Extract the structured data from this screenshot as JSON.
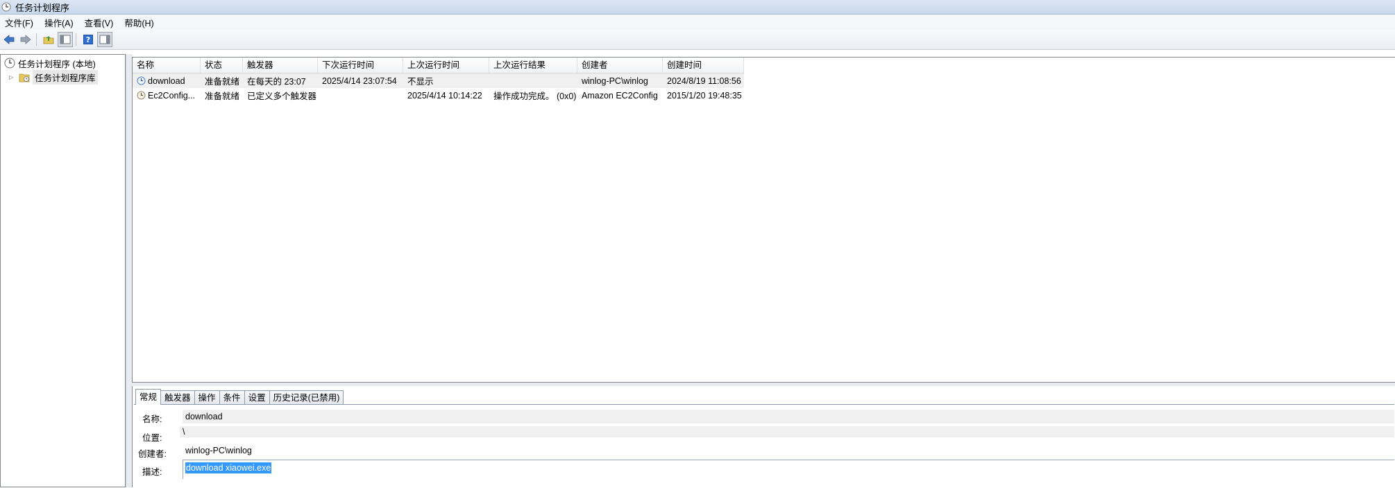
{
  "window": {
    "title": "任务计划程序",
    "icon": "clock-icon"
  },
  "menu": [
    "文件(F)",
    "操作(A)",
    "查看(V)",
    "帮助(H)"
  ],
  "toolbar": {
    "buttons": [
      "back-arrow-icon",
      "forward-arrow-icon",
      "folder-up-icon",
      "show-hide-tree-icon",
      "help-icon",
      "show-hide-action-pane-icon"
    ],
    "colors": {
      "arrow": "#3d78c6",
      "help": "#2f6fd1"
    }
  },
  "tree": {
    "root": "任务计划程序 (本地)",
    "child": "任务计划程序库"
  },
  "list": {
    "columns": [
      "名称",
      "状态",
      "触发器",
      "下次运行时间",
      "上次运行时间",
      "上次运行结果",
      "创建者",
      "创建时间"
    ],
    "rows": [
      {
        "name": "download",
        "status": "准备就绪",
        "trigger": "在每天的 23:07",
        "next_run": "2025/4/14 23:07:54",
        "last_run": "不显示",
        "last_result": "",
        "author": "winlog-PC\\winlog",
        "created": "2024/8/19 11:08:56"
      },
      {
        "name": "Ec2Config...",
        "status": "准备就绪",
        "trigger": "已定义多个触发器",
        "next_run": "",
        "last_run": "2025/4/14 10:14:22",
        "last_result": "操作成功完成。 (0x0)",
        "author": "Amazon EC2Config",
        "created": "2015/1/20 19:48:35"
      }
    ]
  },
  "detail": {
    "tabs": [
      "常规",
      "触发器",
      "操作",
      "条件",
      "设置",
      "历史记录(已禁用)"
    ],
    "labels": {
      "name": "名称:",
      "location": "位置:",
      "author": "创建者:",
      "description": "描述:"
    },
    "values": {
      "name": "download",
      "location": "\\",
      "author": "winlog-PC\\winlog",
      "description": "download xiaowei.exe"
    }
  }
}
